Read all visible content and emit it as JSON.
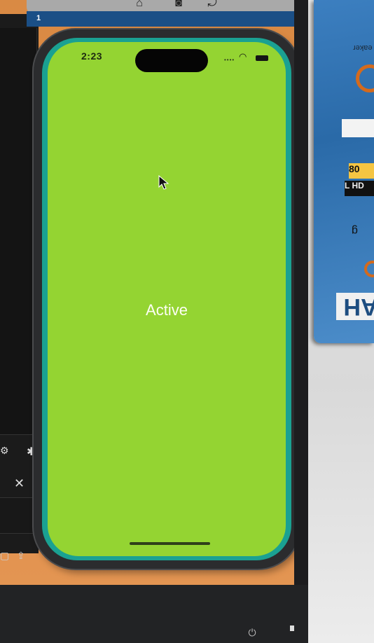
{
  "toolbar": {
    "home_icon": "home-icon",
    "screenshot_icon": "screenshot-icon",
    "rotate_icon": "rotate-icon"
  },
  "tab": {
    "number": "1"
  },
  "device": {
    "status_bar": {
      "time": "2:23"
    },
    "main": {
      "status_text": "Active"
    },
    "background_color": "#94d432",
    "bezel_accent": "#1aa192"
  },
  "promo": {
    "text_fragment": "eaker",
    "badge_top": "80",
    "badge_bottom": "L HD",
    "letters": "g",
    "big_text": "AH"
  }
}
